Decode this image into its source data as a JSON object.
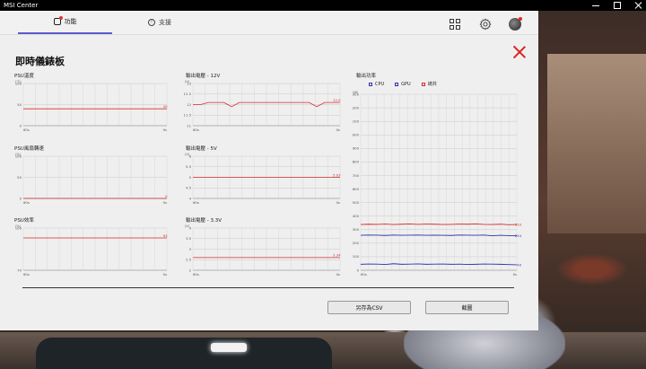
{
  "app": {
    "title": "MSI Center"
  },
  "nav": {
    "tabs": [
      {
        "label": "功能"
      },
      {
        "label": "支援"
      }
    ]
  },
  "page": {
    "title": "即時儀錶板"
  },
  "buttons": {
    "save_csv": "另存為CSV",
    "screenshot": "截圖"
  },
  "colors": {
    "accent": "#5a5ad0",
    "line_red": "#d62a2a",
    "line_blue": "#3030b0",
    "close_red": "#dd2222"
  },
  "chart_data": [
    {
      "id": "psu-temp",
      "type": "line",
      "title": "PSU溫度",
      "unit": "(℃)",
      "ylim": [
        0,
        100
      ],
      "yticks": [
        "100",
        "50",
        "0"
      ],
      "x_start": "60s",
      "x_end": "0s",
      "series": [
        {
          "color": "#d62a2a",
          "values": [
            40,
            40,
            40,
            40,
            40,
            40,
            40,
            40,
            40,
            40,
            40,
            40,
            40,
            40,
            40,
            40,
            40,
            40,
            40,
            40
          ],
          "label": "40"
        }
      ]
    },
    {
      "id": "v12",
      "type": "line",
      "title": "輸出電壓 - 12V",
      "unit": "(V)",
      "ylim": [
        11,
        13
      ],
      "yticks": [
        "13",
        "12.5",
        "12",
        "11.5",
        "11"
      ],
      "x_start": "60s",
      "x_end": "0s",
      "series": [
        {
          "color": "#d62a2a",
          "values": [
            12.0,
            12.0,
            12.1,
            12.1,
            12.1,
            11.9,
            12.1,
            12.1,
            12.1,
            12.1,
            12.1,
            12.1,
            12.1,
            12.1,
            12.1,
            12.1,
            11.9,
            12.1,
            12.1,
            12.1
          ],
          "label": "12.0"
        }
      ]
    },
    {
      "id": "psu-fan",
      "type": "line",
      "title": "PSU風扇轉速",
      "unit": "(%)",
      "ylim": [
        0,
        100
      ],
      "yticks": [
        "100",
        "50",
        "0"
      ],
      "x_start": "60s",
      "x_end": "0s",
      "series": [
        {
          "color": "#d62a2a",
          "values": [
            0,
            0,
            0,
            0,
            0,
            0,
            0,
            0,
            0,
            0,
            0,
            0,
            0,
            0,
            0,
            0,
            0,
            0,
            0,
            0
          ],
          "label": "0"
        }
      ]
    },
    {
      "id": "v5",
      "type": "line",
      "title": "輸出電壓 - 5V",
      "unit": "(V)",
      "ylim": [
        4,
        6
      ],
      "yticks": [
        "6",
        "5.5",
        "5",
        "4.5",
        "4"
      ],
      "x_start": "60s",
      "x_end": "0s",
      "series": [
        {
          "color": "#d62a2a",
          "values": [
            5.0,
            5.0,
            5.0,
            5.0,
            5.0,
            5.0,
            5.0,
            5.0,
            5.0,
            5.0,
            5.0,
            5.0,
            5.0,
            5.0,
            5.0,
            5.0,
            5.0,
            5.0,
            5.0,
            5.0
          ],
          "label": "5.03"
        }
      ]
    },
    {
      "id": "psu-eff",
      "type": "line",
      "title": "PSU效率",
      "unit": "(%)",
      "ylim": [
        70,
        100
      ],
      "yticks": [
        "100",
        "70"
      ],
      "x_start": "60s",
      "x_end": "0s",
      "series": [
        {
          "color": "#d62a2a",
          "values": [
            93,
            93,
            93,
            93,
            93,
            93,
            93,
            93,
            93,
            93,
            93,
            93,
            93,
            93,
            93,
            93,
            93,
            93,
            93,
            93
          ],
          "label": "93"
        }
      ]
    },
    {
      "id": "v33",
      "type": "line",
      "title": "輸出電壓 - 3.3V",
      "unit": "(V)",
      "ylim": [
        3,
        4
      ],
      "yticks": [
        "4",
        "3.5",
        "3",
        "2.5",
        "2"
      ],
      "x_start": "60s",
      "x_end": "0s",
      "series": [
        {
          "color": "#d62a2a",
          "values": [
            3.3,
            3.3,
            3.3,
            3.3,
            3.3,
            3.3,
            3.3,
            3.3,
            3.3,
            3.3,
            3.3,
            3.3,
            3.3,
            3.3,
            3.3,
            3.3,
            3.3,
            3.3,
            3.3,
            3.3
          ],
          "label": "3.34"
        }
      ]
    },
    {
      "id": "power",
      "type": "line",
      "title": "輸出功率",
      "unit": "(W)",
      "ylim": [
        0,
        1300
      ],
      "yticks": [
        "1300",
        "1200",
        "1100",
        "1000",
        "900",
        "800",
        "700",
        "600",
        "500",
        "400",
        "300",
        "200",
        "100",
        "0"
      ],
      "x_start": "60s",
      "x_end": "0s",
      "legend": [
        {
          "name": "CPU",
          "color": "#3030b0"
        },
        {
          "name": "GPU",
          "color": "#3030b0"
        },
        {
          "name": "總共",
          "color": "#d62a2a"
        }
      ],
      "series": [
        {
          "name": "總共",
          "color": "#d62a2a",
          "label": "333",
          "values": [
            338,
            340,
            339,
            341,
            338,
            340,
            342,
            339,
            341,
            340,
            338,
            339,
            341,
            340,
            342,
            339,
            338,
            340,
            336,
            338
          ]
        },
        {
          "name": "GPU",
          "color": "#3030b0",
          "label": "254",
          "values": [
            258,
            260,
            259,
            257,
            260,
            258,
            259,
            260,
            258,
            259,
            258,
            257,
            260,
            259,
            258,
            260,
            255,
            258,
            256,
            254
          ]
        },
        {
          "name": "CPU",
          "color": "#3030b0",
          "label": "40",
          "values": [
            44,
            46,
            45,
            43,
            48,
            44,
            45,
            47,
            44,
            45,
            46,
            44,
            45,
            43,
            44,
            46,
            45,
            44,
            42,
            40
          ]
        }
      ]
    }
  ]
}
